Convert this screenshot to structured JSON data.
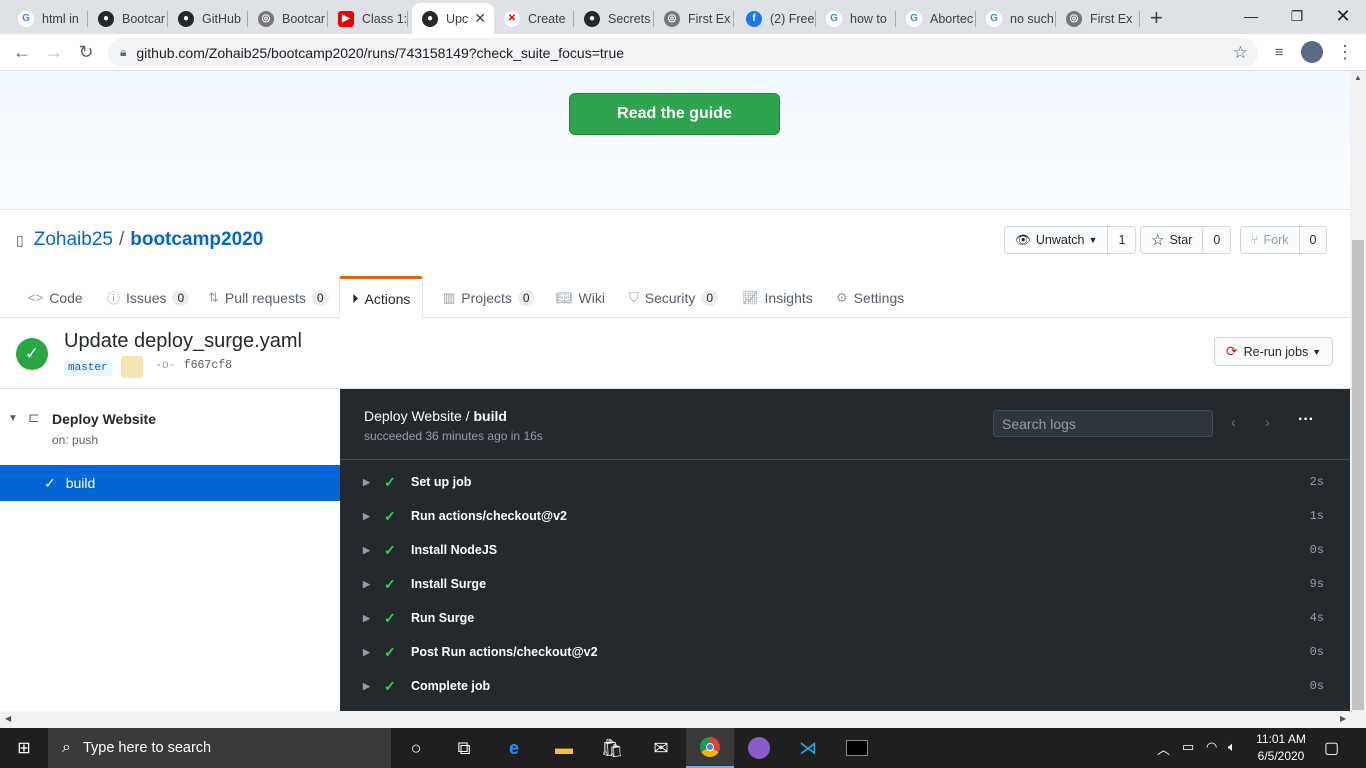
{
  "browser": {
    "tabs": [
      {
        "title": "html in",
        "icon": "google-icon"
      },
      {
        "title": "Bootcar",
        "icon": "github-icon"
      },
      {
        "title": "GitHub",
        "icon": "github-icon"
      },
      {
        "title": "Bootcar",
        "icon": "globe-icon"
      },
      {
        "title": "Class 1:",
        "icon": "youtube-icon"
      },
      {
        "title": "Upc",
        "icon": "github-icon",
        "active": true
      },
      {
        "title": "Create",
        "icon": "error-icon"
      },
      {
        "title": "Secrets",
        "icon": "github-icon"
      },
      {
        "title": "First Ex",
        "icon": "globe-icon"
      },
      {
        "title": "(2) Free",
        "icon": "facebook-icon"
      },
      {
        "title": "how to",
        "icon": "google-icon"
      },
      {
        "title": "Abortec",
        "icon": "google-icon"
      },
      {
        "title": "no such",
        "icon": "google-icon"
      },
      {
        "title": "First Ex",
        "icon": "globe-icon"
      }
    ],
    "url": "github.com/Zohaib25/bootcamp2020/runs/743158149?check_suite_focus=true"
  },
  "hero": {
    "guide_button": "Read the guide"
  },
  "repo": {
    "owner": "Zohaib25",
    "separator": "/",
    "name": "bootcamp2020",
    "unwatch_label": "Unwatch",
    "watch_count": "1",
    "star_label": "Star",
    "star_count": "0",
    "fork_label": "Fork",
    "fork_count": "0"
  },
  "nav": {
    "code": "Code",
    "issues": "Issues",
    "issues_count": "0",
    "pulls": "Pull requests",
    "pulls_count": "0",
    "actions": "Actions",
    "projects": "Projects",
    "projects_count": "0",
    "wiki": "Wiki",
    "security": "Security",
    "security_count": "0",
    "insights": "Insights",
    "settings": "Settings"
  },
  "run": {
    "title": "Update deploy_surge.yaml",
    "branch": "master",
    "commit": "f667cf8",
    "rerun_label": "Re-run jobs"
  },
  "sidebar": {
    "workflow": "Deploy Website",
    "trigger": "on: push",
    "job": "build"
  },
  "logs": {
    "workflow": "Deploy Website",
    "separator": " / ",
    "job": "build",
    "status": "succeeded 36 minutes ago in 16s",
    "search_placeholder": "Search logs",
    "steps": [
      {
        "name": "Set up job",
        "time": "2s"
      },
      {
        "name": "Run actions/checkout@v2",
        "time": "1s"
      },
      {
        "name": "Install NodeJS",
        "time": "0s"
      },
      {
        "name": "Install Surge",
        "time": "9s"
      },
      {
        "name": "Run Surge",
        "time": "4s"
      },
      {
        "name": "Post Run actions/checkout@v2",
        "time": "0s"
      },
      {
        "name": "Complete job",
        "time": "0s"
      }
    ]
  },
  "taskbar": {
    "search_placeholder": "Type here to search",
    "time": "11:01 AM",
    "date": "6/5/2020"
  },
  "colors": {
    "accent_green": "#2ea44f",
    "link_blue": "#0366d6",
    "active_tab_orange": "#e36209",
    "log_bg": "#24292e"
  }
}
